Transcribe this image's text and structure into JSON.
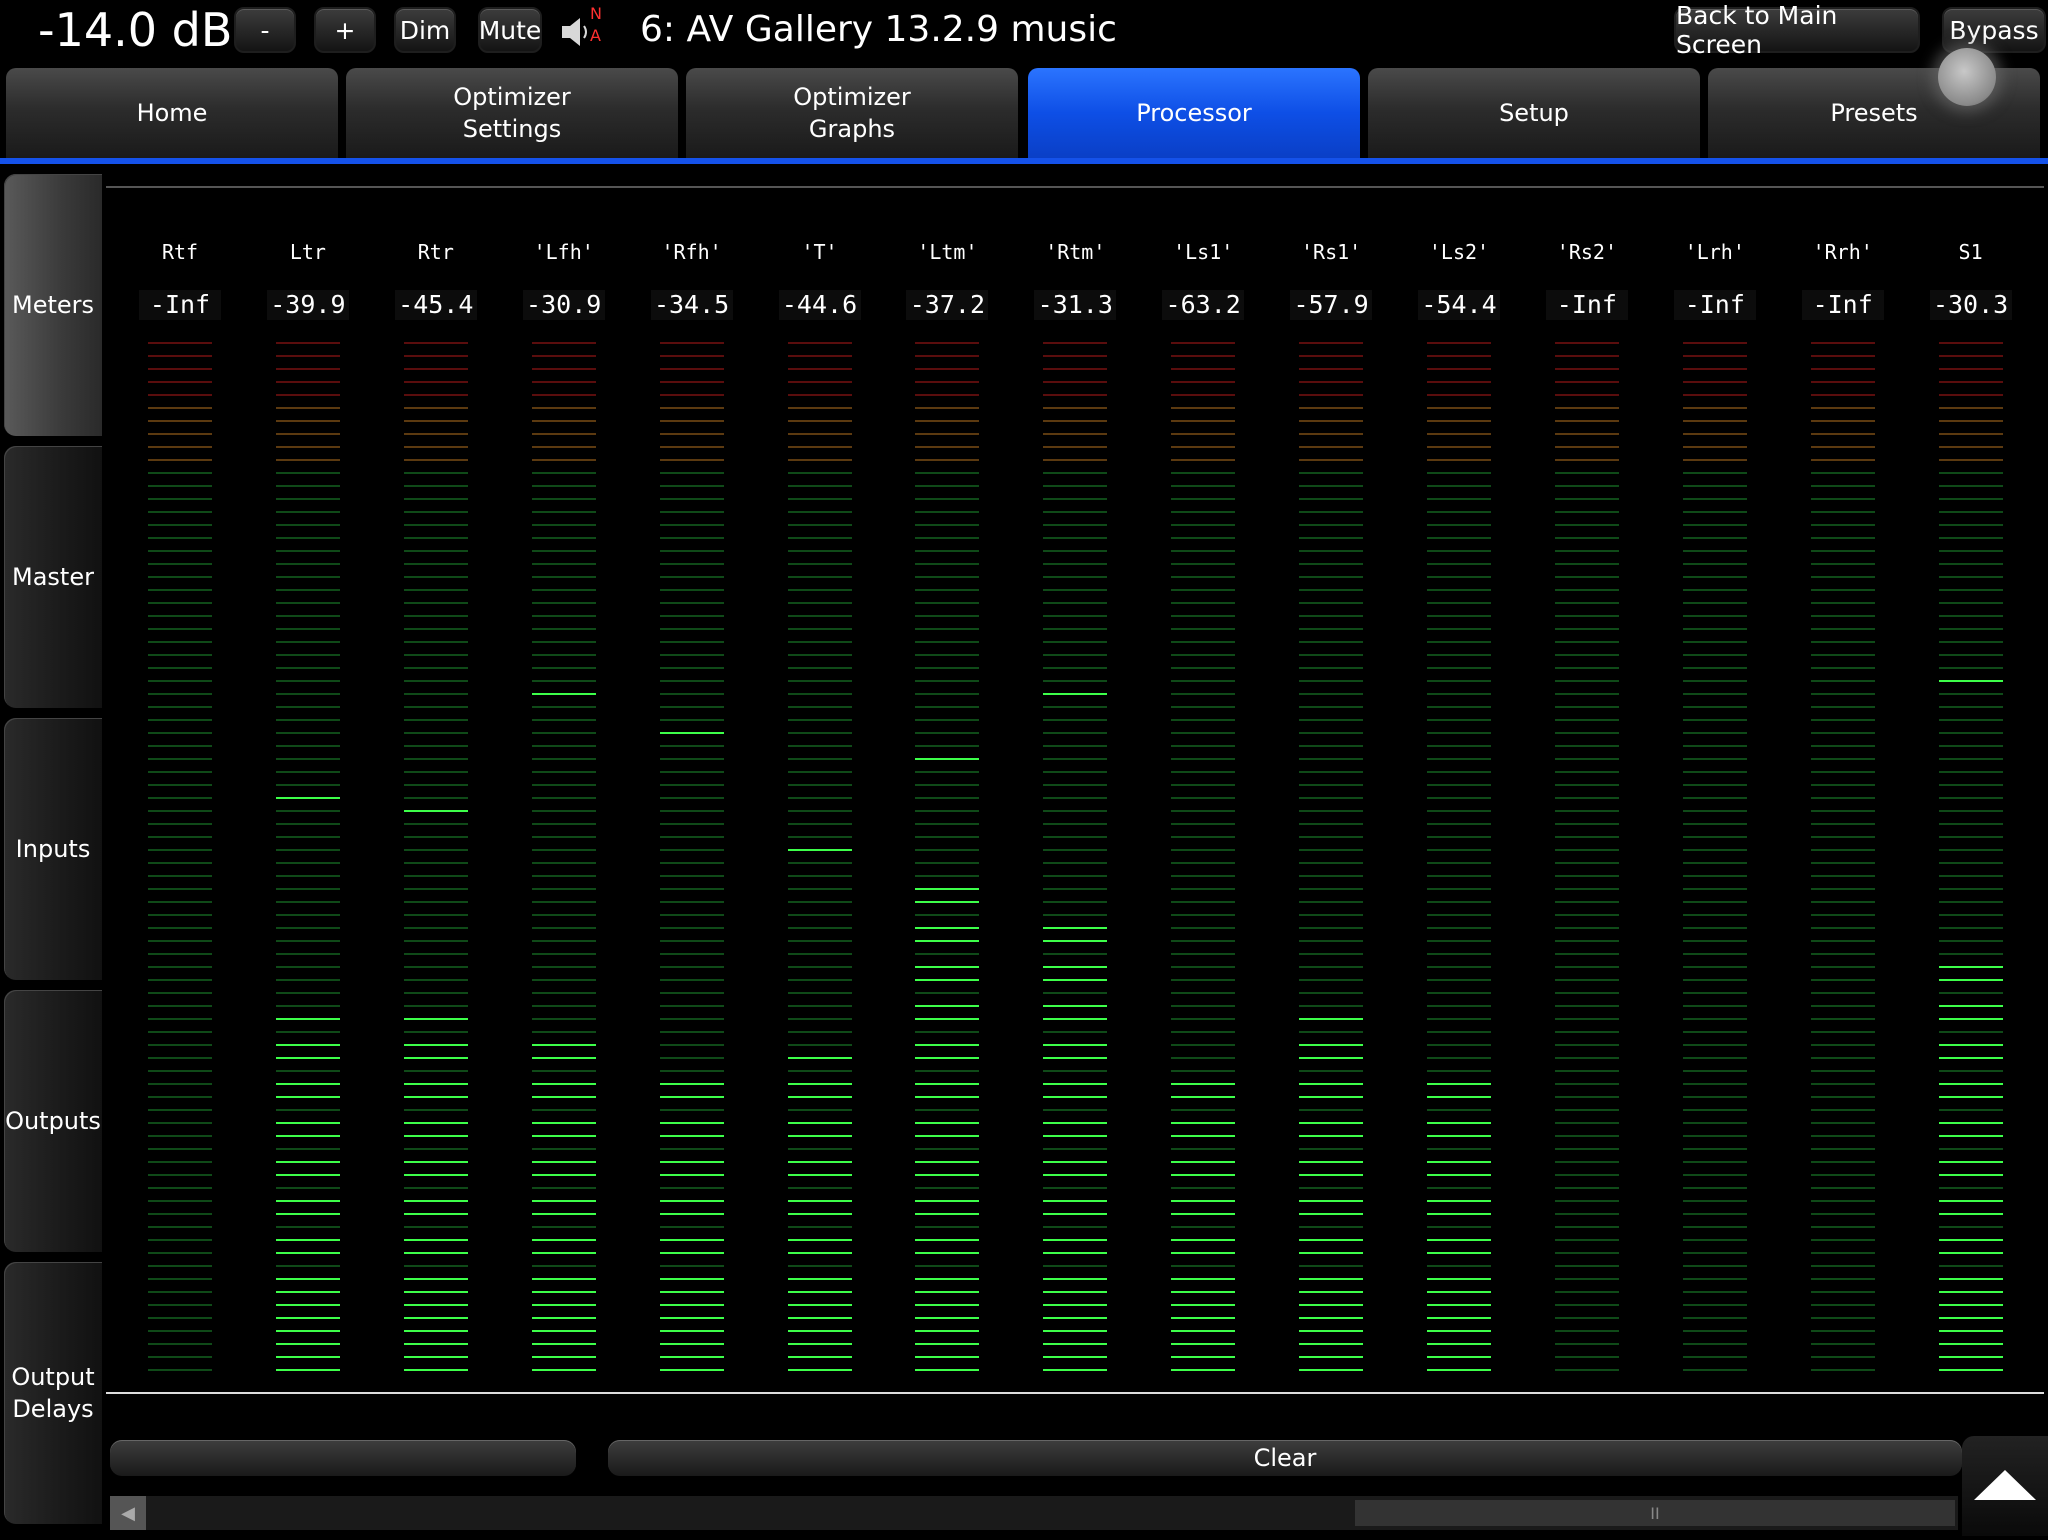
{
  "topbar": {
    "volume": "-14.0 dB",
    "minus_label": "-",
    "plus_label": "+",
    "dim_label": "Dim",
    "mute_label": "Mute",
    "speaker_badge_top": "N",
    "speaker_badge_bottom": "A",
    "preset_name": "6: AV Gallery 13.2.9 music",
    "back_label": "Back to Main Screen",
    "bypass_label": "Bypass"
  },
  "tabs": [
    {
      "line1": "Home",
      "line2": ""
    },
    {
      "line1": "Optimizer",
      "line2": "Settings"
    },
    {
      "line1": "Optimizer",
      "line2": "Graphs"
    },
    {
      "line1": "Processor",
      "line2": ""
    },
    {
      "line1": "Setup",
      "line2": ""
    },
    {
      "line1": "Presets",
      "line2": ""
    }
  ],
  "active_tab": 3,
  "sidenav": [
    {
      "line1": "Meters",
      "line2": ""
    },
    {
      "line1": "Master",
      "line2": ""
    },
    {
      "line1": "Inputs",
      "line2": ""
    },
    {
      "line1": "Outputs",
      "line2": ""
    },
    {
      "line1": "Output",
      "line2": "Delays"
    }
  ],
  "active_sidenav": 0,
  "meter_scale": {
    "segments": 80,
    "red_segments": 5,
    "orange_segments": 5
  },
  "channels": [
    {
      "name": "Rtf",
      "value": "-Inf",
      "lit_segments": 0,
      "peak_segment": null
    },
    {
      "name": "Ltr",
      "value": "-39.9",
      "lit_segments": 28,
      "peak_segment": 44
    },
    {
      "name": "Rtr",
      "value": "-45.4",
      "lit_segments": 28,
      "peak_segment": 43
    },
    {
      "name": "'Lfh'",
      "value": "-30.9",
      "lit_segments": 27,
      "peak_segment": 52
    },
    {
      "name": "'Rfh'",
      "value": "-34.5",
      "lit_segments": 24,
      "peak_segment": 49
    },
    {
      "name": "'T'",
      "value": "-44.6",
      "lit_segments": 25,
      "peak_segment": 40
    },
    {
      "name": "'Ltm'",
      "value": "-37.2",
      "lit_segments": 39,
      "peak_segment": 47
    },
    {
      "name": "'Rtm'",
      "value": "-31.3",
      "lit_segments": 36,
      "peak_segment": 52
    },
    {
      "name": "'Ls1'",
      "value": "-63.2",
      "lit_segments": 24,
      "peak_segment": null
    },
    {
      "name": "'Rs1'",
      "value": "-57.9",
      "lit_segments": 28,
      "peak_segment": null
    },
    {
      "name": "'Ls2'",
      "value": "-54.4",
      "lit_segments": 23,
      "peak_segment": null
    },
    {
      "name": "'Rs2'",
      "value": "-Inf",
      "lit_segments": 0,
      "peak_segment": null
    },
    {
      "name": "'Lrh'",
      "value": "-Inf",
      "lit_segments": 0,
      "peak_segment": null
    },
    {
      "name": "'Rrh'",
      "value": "-Inf",
      "lit_segments": 0,
      "peak_segment": null
    },
    {
      "name": "S1",
      "value": "-30.3",
      "lit_segments": 32,
      "peak_segment": 53
    }
  ],
  "bottom": {
    "clear_label": "Clear",
    "scroll_left": "◀",
    "scroll_grip": "II"
  },
  "colors": {
    "accent": "#1552ea",
    "seg_red_off": "#5a0d0d",
    "seg_orange_off": "#5c3a10",
    "seg_green_off": "#0f4a18",
    "seg_green_on": "#3dff4a"
  }
}
